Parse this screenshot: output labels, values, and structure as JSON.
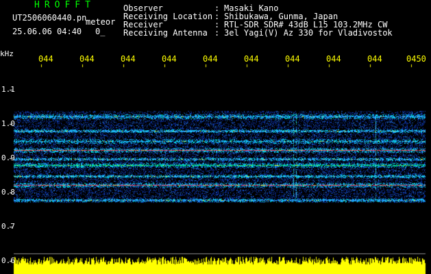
{
  "header": {
    "title": "HROFFT",
    "filename": "UT2506060440.pn",
    "meteor_label": "meteor",
    "date_time": "25.06.06 04:40",
    "extra": "0_",
    "info": [
      {
        "label": "Observer",
        "value": "Masaki Kano"
      },
      {
        "label": "Receiving Location",
        "value": "Shibukawa, Gunma, Japan"
      },
      {
        "label": "Receiver",
        "value": "RTL-SDR SDR# 43dB L15 103.2MHz CW"
      },
      {
        "label": "Receiving Antenna",
        "value": "3el Yagi(V) Az 330 for Vladivostok"
      }
    ]
  },
  "axes": {
    "y_unit": "kHz",
    "y_ticks": [
      "1.1",
      "1.0",
      "0.9",
      "0.8",
      "0.7",
      "0.6"
    ],
    "x_ticks": [
      "044",
      "044",
      "044",
      "044",
      "044",
      "044",
      "044",
      "044",
      "044",
      "0450"
    ]
  },
  "colors": {
    "background": "#000000",
    "header_title": "#00ff00",
    "header_text": "#ffffff",
    "time_ticks": "#ffff00",
    "signal_strip": "#ffff00",
    "strong_line": "#ff2a40",
    "medium_line": "#00e060",
    "noise": "#1040c0"
  }
}
